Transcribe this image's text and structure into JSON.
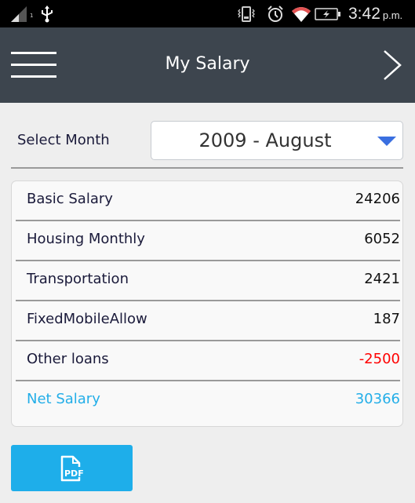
{
  "status_bar": {
    "sim_slot": "1",
    "time": "3:42",
    "ampm": "p.m.",
    "icons": [
      "signal-icon",
      "usb-icon",
      "vibrate-icon",
      "alarm-icon",
      "wifi-icon",
      "battery-charging-icon"
    ]
  },
  "header": {
    "title": "My Salary",
    "menu_icon": "hamburger-menu-icon",
    "next_icon": "chevron-right-icon"
  },
  "month_selector": {
    "label": "Select Month",
    "selected": "2009 - August",
    "arrow_color": "#3a6fe0"
  },
  "salary": {
    "rows": [
      {
        "label": "Basic Salary",
        "value": "24206"
      },
      {
        "label": "Housing Monthly",
        "value": "6052"
      },
      {
        "label": "Transportation",
        "value": "2421"
      },
      {
        "label": "FixedMobileAllow",
        "value": "187"
      },
      {
        "label": "Other loans",
        "value": "-2500"
      },
      {
        "label": "Net Salary",
        "value": "30366"
      }
    ],
    "negative_color": "#ff0000",
    "net_color": "#23aee8"
  },
  "pdf_button": {
    "icon": "pdf-file-icon",
    "icon_text": "PDF",
    "color": "#1eaeea"
  }
}
